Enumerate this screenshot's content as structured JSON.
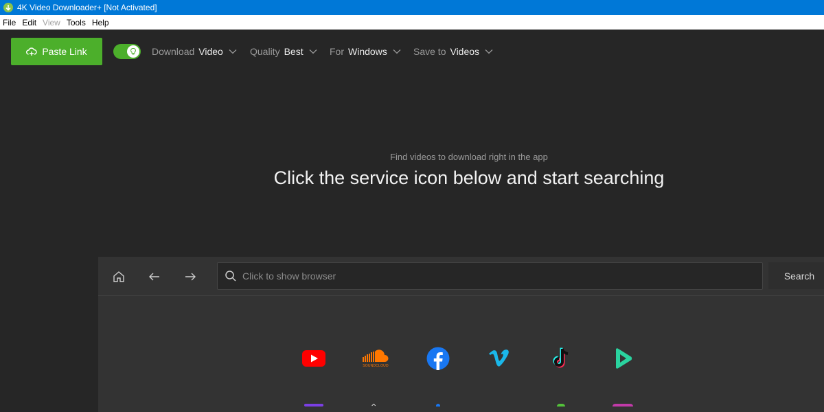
{
  "window": {
    "title": "4K Video Downloader+ [Not Activated]"
  },
  "menu": {
    "items": [
      "File",
      "Edit",
      "View",
      "Tools",
      "Help"
    ]
  },
  "toolbar": {
    "paste_label": "Paste Link",
    "download": {
      "label": "Download",
      "value": "Video"
    },
    "quality": {
      "label": "Quality",
      "value": "Best"
    },
    "platform": {
      "label": "For",
      "value": "Windows"
    },
    "save": {
      "label": "Save to",
      "value": "Videos"
    },
    "toggle_on": true
  },
  "hero": {
    "subtitle": "Find videos to download right in the app",
    "title": "Click the service icon below and start searching"
  },
  "browser": {
    "url_placeholder": "Click to show browser",
    "search_label": "Search"
  },
  "services": [
    {
      "name": "youtube",
      "icon": "youtube-icon"
    },
    {
      "name": "soundcloud",
      "icon": "soundcloud-icon",
      "text": "SOUNDCLOUD"
    },
    {
      "name": "facebook",
      "icon": "facebook-icon"
    },
    {
      "name": "vimeo",
      "icon": "vimeo-icon"
    },
    {
      "name": "tiktok",
      "icon": "tiktok-icon"
    },
    {
      "name": "rumble",
      "icon": "play-icon"
    }
  ],
  "colors": {
    "accent": "#4caf2b",
    "titlebar": "#0078d7"
  }
}
